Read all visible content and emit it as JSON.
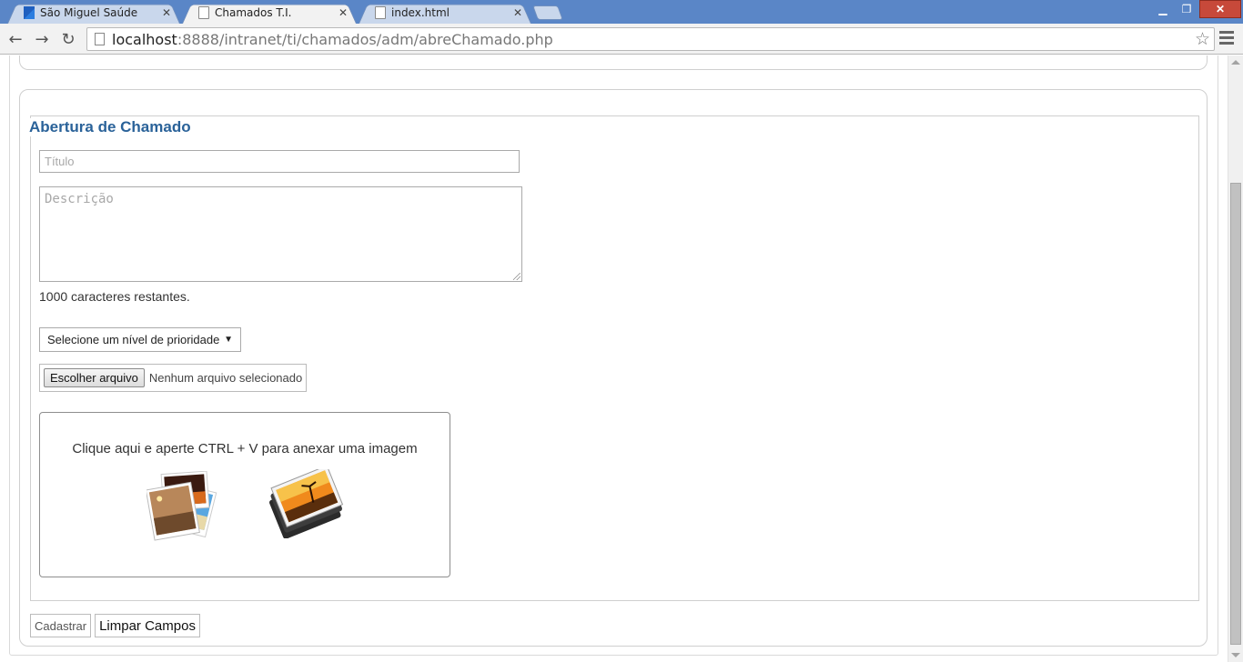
{
  "browser": {
    "tabs": [
      {
        "title": "São Miguel Saúde",
        "active": false
      },
      {
        "title": "Chamados T.I.",
        "active": true
      },
      {
        "title": "index.html",
        "active": false
      }
    ],
    "url_host": "localhost",
    "url_rest": ":8888/intranet/ti/chamados/adm/abreChamado.php"
  },
  "form": {
    "legend": "Abertura de Chamado",
    "title_placeholder": "Título",
    "description_placeholder": "Descrição",
    "remaining_text": "1000 caracteres restantes.",
    "priority_selected": "Selecione um nível de prioridade",
    "file_button": "Escolher arquivo",
    "file_status": "Nenhum arquivo selecionado",
    "paste_instruction": "Clique aqui e aperte CTRL + V para anexar uma imagem",
    "submit_label": "Cadastrar",
    "reset_label": "Limpar Campos"
  },
  "icons": {
    "back": "back-arrow-icon",
    "forward": "forward-arrow-icon",
    "reload": "reload-icon",
    "bookmark": "star-icon",
    "menu": "hamburger-menu-icon"
  }
}
